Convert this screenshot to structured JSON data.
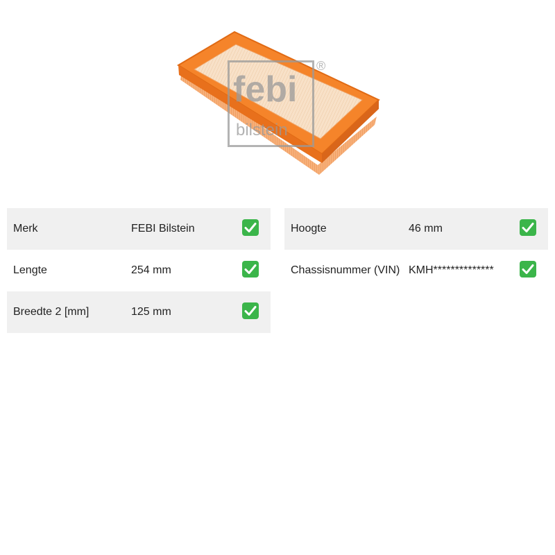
{
  "product_image": {
    "alt": "FEBI Bilstein luchtfilter",
    "watermark_line1": "febi",
    "watermark_line2": "bilstein",
    "watermark_mark": "®",
    "colors": {
      "frame": "#f5842a",
      "media": "#f7dcc0",
      "watermark": "#9a9a9a"
    }
  },
  "specs_left": [
    {
      "label": "Merk",
      "value": "FEBI Bilstein",
      "checked": true,
      "shaded": true
    },
    {
      "label": "Lengte",
      "value": "254 mm",
      "checked": true,
      "shaded": false
    },
    {
      "label": "Breedte 2 [mm]",
      "value": "125 mm",
      "checked": true,
      "shaded": true
    }
  ],
  "specs_right": [
    {
      "label": "Hoogte",
      "value": "46 mm",
      "checked": true,
      "shaded": true
    },
    {
      "label": "Chassisnummer (VIN)",
      "value": "KMH**************",
      "checked": true,
      "shaded": false
    }
  ],
  "icons": {
    "check": "check-mark-button-icon"
  },
  "colors": {
    "row_shade": "#f0f0f0",
    "check": "#3bb54a",
    "text": "#222222"
  }
}
